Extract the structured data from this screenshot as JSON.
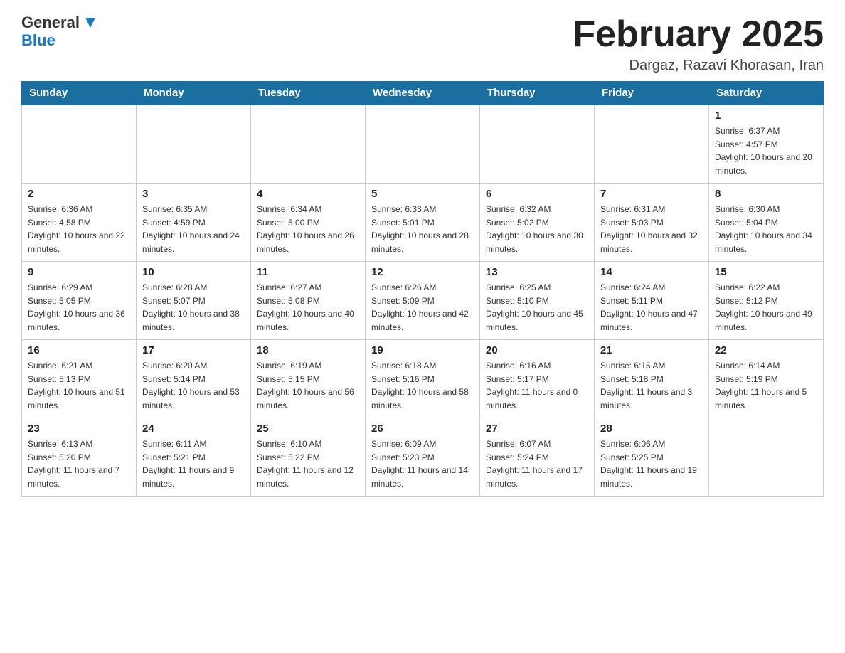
{
  "header": {
    "logo_general": "General",
    "logo_blue": "Blue",
    "month_title": "February 2025",
    "location": "Dargaz, Razavi Khorasan, Iran"
  },
  "weekdays": [
    "Sunday",
    "Monday",
    "Tuesday",
    "Wednesday",
    "Thursday",
    "Friday",
    "Saturday"
  ],
  "weeks": [
    [
      {
        "day": "",
        "sunrise": "",
        "sunset": "",
        "daylight": ""
      },
      {
        "day": "",
        "sunrise": "",
        "sunset": "",
        "daylight": ""
      },
      {
        "day": "",
        "sunrise": "",
        "sunset": "",
        "daylight": ""
      },
      {
        "day": "",
        "sunrise": "",
        "sunset": "",
        "daylight": ""
      },
      {
        "day": "",
        "sunrise": "",
        "sunset": "",
        "daylight": ""
      },
      {
        "day": "",
        "sunrise": "",
        "sunset": "",
        "daylight": ""
      },
      {
        "day": "1",
        "sunrise": "Sunrise: 6:37 AM",
        "sunset": "Sunset: 4:57 PM",
        "daylight": "Daylight: 10 hours and 20 minutes."
      }
    ],
    [
      {
        "day": "2",
        "sunrise": "Sunrise: 6:36 AM",
        "sunset": "Sunset: 4:58 PM",
        "daylight": "Daylight: 10 hours and 22 minutes."
      },
      {
        "day": "3",
        "sunrise": "Sunrise: 6:35 AM",
        "sunset": "Sunset: 4:59 PM",
        "daylight": "Daylight: 10 hours and 24 minutes."
      },
      {
        "day": "4",
        "sunrise": "Sunrise: 6:34 AM",
        "sunset": "Sunset: 5:00 PM",
        "daylight": "Daylight: 10 hours and 26 minutes."
      },
      {
        "day": "5",
        "sunrise": "Sunrise: 6:33 AM",
        "sunset": "Sunset: 5:01 PM",
        "daylight": "Daylight: 10 hours and 28 minutes."
      },
      {
        "day": "6",
        "sunrise": "Sunrise: 6:32 AM",
        "sunset": "Sunset: 5:02 PM",
        "daylight": "Daylight: 10 hours and 30 minutes."
      },
      {
        "day": "7",
        "sunrise": "Sunrise: 6:31 AM",
        "sunset": "Sunset: 5:03 PM",
        "daylight": "Daylight: 10 hours and 32 minutes."
      },
      {
        "day": "8",
        "sunrise": "Sunrise: 6:30 AM",
        "sunset": "Sunset: 5:04 PM",
        "daylight": "Daylight: 10 hours and 34 minutes."
      }
    ],
    [
      {
        "day": "9",
        "sunrise": "Sunrise: 6:29 AM",
        "sunset": "Sunset: 5:05 PM",
        "daylight": "Daylight: 10 hours and 36 minutes."
      },
      {
        "day": "10",
        "sunrise": "Sunrise: 6:28 AM",
        "sunset": "Sunset: 5:07 PM",
        "daylight": "Daylight: 10 hours and 38 minutes."
      },
      {
        "day": "11",
        "sunrise": "Sunrise: 6:27 AM",
        "sunset": "Sunset: 5:08 PM",
        "daylight": "Daylight: 10 hours and 40 minutes."
      },
      {
        "day": "12",
        "sunrise": "Sunrise: 6:26 AM",
        "sunset": "Sunset: 5:09 PM",
        "daylight": "Daylight: 10 hours and 42 minutes."
      },
      {
        "day": "13",
        "sunrise": "Sunrise: 6:25 AM",
        "sunset": "Sunset: 5:10 PM",
        "daylight": "Daylight: 10 hours and 45 minutes."
      },
      {
        "day": "14",
        "sunrise": "Sunrise: 6:24 AM",
        "sunset": "Sunset: 5:11 PM",
        "daylight": "Daylight: 10 hours and 47 minutes."
      },
      {
        "day": "15",
        "sunrise": "Sunrise: 6:22 AM",
        "sunset": "Sunset: 5:12 PM",
        "daylight": "Daylight: 10 hours and 49 minutes."
      }
    ],
    [
      {
        "day": "16",
        "sunrise": "Sunrise: 6:21 AM",
        "sunset": "Sunset: 5:13 PM",
        "daylight": "Daylight: 10 hours and 51 minutes."
      },
      {
        "day": "17",
        "sunrise": "Sunrise: 6:20 AM",
        "sunset": "Sunset: 5:14 PM",
        "daylight": "Daylight: 10 hours and 53 minutes."
      },
      {
        "day": "18",
        "sunrise": "Sunrise: 6:19 AM",
        "sunset": "Sunset: 5:15 PM",
        "daylight": "Daylight: 10 hours and 56 minutes."
      },
      {
        "day": "19",
        "sunrise": "Sunrise: 6:18 AM",
        "sunset": "Sunset: 5:16 PM",
        "daylight": "Daylight: 10 hours and 58 minutes."
      },
      {
        "day": "20",
        "sunrise": "Sunrise: 6:16 AM",
        "sunset": "Sunset: 5:17 PM",
        "daylight": "Daylight: 11 hours and 0 minutes."
      },
      {
        "day": "21",
        "sunrise": "Sunrise: 6:15 AM",
        "sunset": "Sunset: 5:18 PM",
        "daylight": "Daylight: 11 hours and 3 minutes."
      },
      {
        "day": "22",
        "sunrise": "Sunrise: 6:14 AM",
        "sunset": "Sunset: 5:19 PM",
        "daylight": "Daylight: 11 hours and 5 minutes."
      }
    ],
    [
      {
        "day": "23",
        "sunrise": "Sunrise: 6:13 AM",
        "sunset": "Sunset: 5:20 PM",
        "daylight": "Daylight: 11 hours and 7 minutes."
      },
      {
        "day": "24",
        "sunrise": "Sunrise: 6:11 AM",
        "sunset": "Sunset: 5:21 PM",
        "daylight": "Daylight: 11 hours and 9 minutes."
      },
      {
        "day": "25",
        "sunrise": "Sunrise: 6:10 AM",
        "sunset": "Sunset: 5:22 PM",
        "daylight": "Daylight: 11 hours and 12 minutes."
      },
      {
        "day": "26",
        "sunrise": "Sunrise: 6:09 AM",
        "sunset": "Sunset: 5:23 PM",
        "daylight": "Daylight: 11 hours and 14 minutes."
      },
      {
        "day": "27",
        "sunrise": "Sunrise: 6:07 AM",
        "sunset": "Sunset: 5:24 PM",
        "daylight": "Daylight: 11 hours and 17 minutes."
      },
      {
        "day": "28",
        "sunrise": "Sunrise: 6:06 AM",
        "sunset": "Sunset: 5:25 PM",
        "daylight": "Daylight: 11 hours and 19 minutes."
      },
      {
        "day": "",
        "sunrise": "",
        "sunset": "",
        "daylight": ""
      }
    ]
  ]
}
